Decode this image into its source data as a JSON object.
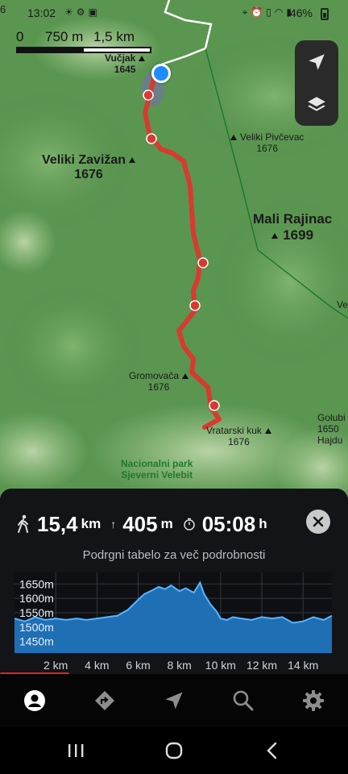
{
  "status_bar": {
    "time": "13:02",
    "left_icons": [
      "sun-icon",
      "settings-icon",
      "image-icon"
    ],
    "right_icons": [
      "location-icon",
      "alarm-icon",
      "vibrate-icon",
      "wifi-icon",
      "signal-icon"
    ],
    "battery": "46%",
    "edge_text": "6"
  },
  "map": {
    "scale": {
      "zero": "0",
      "mid": "750 m",
      "end": "1,5 km"
    },
    "peaks": [
      {
        "name": "Vučjak",
        "elevation": "1645"
      },
      {
        "name": "Veliki Pivčevac",
        "elevation": "1676"
      },
      {
        "name": "Veliki Zavižan",
        "elevation": "1676"
      },
      {
        "name": "Mali Rajinac",
        "elevation": "1699"
      },
      {
        "name": "Gromovača",
        "elevation": "1676"
      },
      {
        "name": "Vratarski kuk",
        "elevation": "1676"
      },
      {
        "name": "Golubi",
        "elevation": "1650"
      }
    ],
    "edge_text": {
      "ve": "Ve",
      "hajdu": "Hajdu"
    },
    "park_label": {
      "line1": "Nacionalni park",
      "line2": "Sjeverni Velebit"
    },
    "controls": [
      "navigation-arrow-icon",
      "layers-icon"
    ],
    "route_color": "#d83a30",
    "track_color": "#ffffff",
    "user_location_color": "#1e8cff"
  },
  "route_summary": {
    "distance_value": "15,4",
    "distance_unit": "km",
    "ascent_value": "405",
    "ascent_unit": "m",
    "duration_value": "05:08",
    "duration_unit": "h",
    "hint": "Podrgni tabelo za več podrobnosti"
  },
  "chart_data": {
    "type": "area",
    "x_unit": "km",
    "y_unit": "m",
    "xlim": [
      0,
      15.4
    ],
    "ylim": [
      1410,
      1690
    ],
    "y_ticks": [
      "1650m",
      "1600m",
      "1550m",
      "1500m",
      "1450m"
    ],
    "x_ticks": [
      "2 km",
      "4 km",
      "6 km",
      "8 km",
      "10 km",
      "12 km",
      "14 km"
    ],
    "fill_color": "#1f6fb5",
    "line_color": "#5ab4ff",
    "x": [
      0,
      0.5,
      1,
      1.5,
      2,
      2.5,
      3,
      3.5,
      4,
      4.5,
      5,
      5.5,
      6,
      6.3,
      6.6,
      7,
      7.3,
      7.6,
      8,
      8.3,
      8.7,
      9,
      9.2,
      9.5,
      9.8,
      10,
      10.3,
      10.6,
      11,
      11.5,
      12,
      12.5,
      13,
      13.5,
      14,
      14.5,
      15,
      15.4
    ],
    "y": [
      1530,
      1520,
      1535,
      1525,
      1530,
      1525,
      1530,
      1525,
      1530,
      1535,
      1540,
      1560,
      1595,
      1615,
      1625,
      1640,
      1632,
      1645,
      1625,
      1635,
      1620,
      1655,
      1615,
      1580,
      1555,
      1530,
      1525,
      1535,
      1530,
      1525,
      1535,
      1530,
      1535,
      1515,
      1520,
      1535,
      1525,
      1540
    ]
  },
  "tabs": [
    {
      "name": "tab-profile",
      "icon": "user-icon"
    },
    {
      "name": "tab-routes",
      "icon": "route-sign-icon"
    },
    {
      "name": "tab-navigate",
      "icon": "navigation-arrow-icon"
    },
    {
      "name": "tab-search",
      "icon": "search-icon"
    },
    {
      "name": "tab-settings",
      "icon": "gear-icon"
    }
  ],
  "system_nav": [
    "recent-apps-icon",
    "home-icon",
    "back-icon"
  ]
}
